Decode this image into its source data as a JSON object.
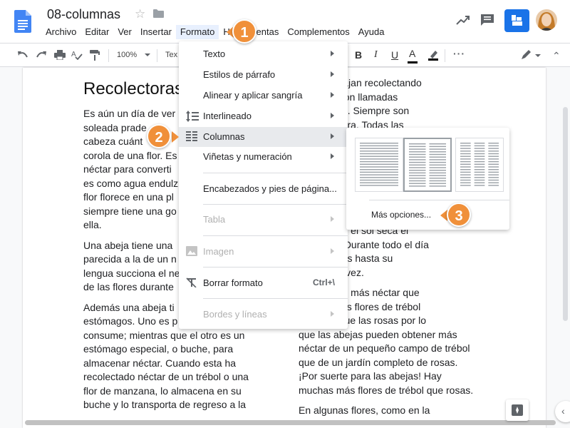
{
  "doc": {
    "title": "08-columnas"
  },
  "menubar": [
    "Archivo",
    "Editar",
    "Ver",
    "Insertar",
    "Formato",
    "Herramientas",
    "Complementos",
    "Ayuda"
  ],
  "toolbar": {
    "zoom": "100%",
    "style_partial": "Tex"
  },
  "colors": {
    "accent": "#1a73e8",
    "callout": "#f0903a",
    "menu_highlight": "#e8eaed"
  },
  "format_menu": {
    "items": [
      {
        "label": "Texto",
        "submenu": true
      },
      {
        "label": "Estilos de párrafo",
        "submenu": true
      },
      {
        "label": "Alinear y aplicar sangría",
        "submenu": true
      },
      {
        "label": "Interlineado",
        "submenu": true,
        "icon": "line-spacing-icon"
      },
      {
        "label": "Columnas",
        "submenu": true,
        "icon": "columns-icon",
        "highlighted": true
      },
      {
        "label": "Viñetas y numeración",
        "submenu": true
      },
      {
        "label": "Encabezados y pies de página..."
      },
      {
        "label": "Tabla",
        "submenu": true,
        "disabled": true
      },
      {
        "label": "Imagen",
        "submenu": true,
        "disabled": true,
        "icon": "image-icon"
      },
      {
        "label": "Borrar formato",
        "shortcut": "Ctrl+\\",
        "icon": "clear-format-icon"
      },
      {
        "label": "Bordes y líneas",
        "submenu": true,
        "disabled": true
      }
    ]
  },
  "columns_submenu": {
    "options": [
      "one-column",
      "two-columns",
      "three-columns"
    ],
    "selected": "two-columns",
    "more_options": "Más opciones..."
  },
  "callouts": [
    "1",
    "2",
    "3"
  ],
  "document": {
    "heading": "Recolectoras",
    "left_column_lines": [
      [
        "Es aún un día de ver",
        "soleada prade",
        "cabeza  cuánt",
        "corola de una flor. Es",
        "néctar para converti",
        "es como agua endulz",
        "flor florece en una pl",
        "siempre tiene una go",
        "ella."
      ],
      [
        "Una abeja tiene una",
        "parecida a la de un n",
        "lengua succiona el ne",
        "de las flores durante"
      ],
      [
        "Además una abeja ti",
        "estómagos. Uno es p",
        "consume; mientras que el otro es un",
        "estómago especial, o buche, para",
        "almacenar néctar. Cuando esta ha",
        "recolectado néctar de un trébol o una",
        "flor de manzana, lo almacena en su",
        "buche y lo transporta de regreso a la"
      ]
    ],
    "right_column_lines": [
      [
        "s que trabajan recolectando",
        "as flores son llamadas",
        "colectoras\". Siempre son",
        "ultas hembra. Todas las"
      ],
      [
        ", en cuanto el sol seca el",
        "s plantas. Durante todo el día",
        "de las flores hasta su",
        "una y otra vez."
      ],
      [
        "ores tienen más néctar que",
        "ejemplo, las flores de trébol",
        "cho más que las rosas por lo",
        "que las abejas pueden obtener más",
        "néctar de un pequeño campo de trébol",
        "que de un jardín completo de rosas.",
        "¡Por suerte para las abejas! Hay",
        "muchas más flores de trébol que rosas."
      ],
      [
        "En algunas flores, como en la"
      ]
    ]
  }
}
